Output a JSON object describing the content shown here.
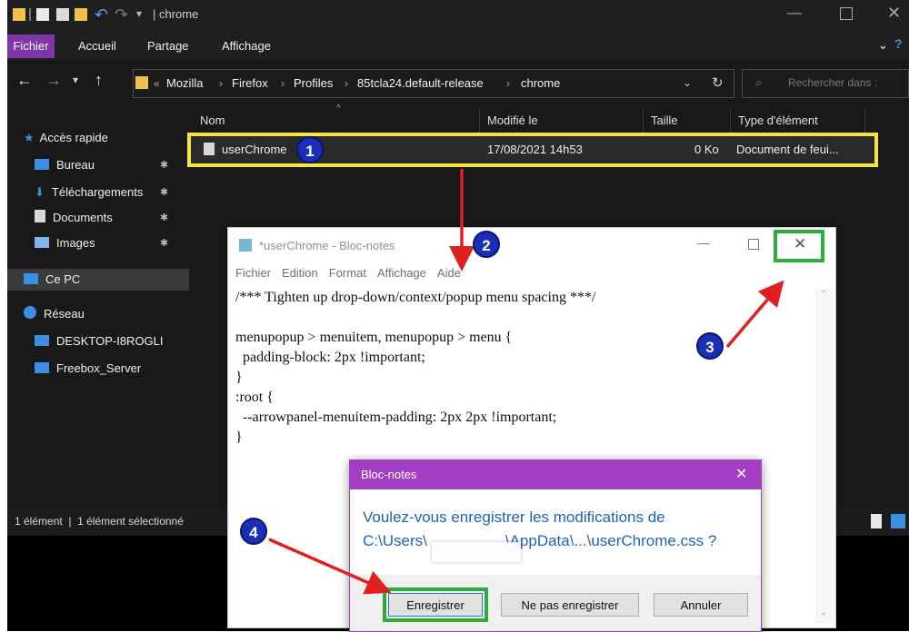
{
  "explorer": {
    "window_title": "chrome",
    "ribbon_tabs": [
      "Fichier",
      "Accueil",
      "Partage",
      "Affichage"
    ],
    "address": [
      "Mozilla",
      "Firefox",
      "Profiles",
      "85tcla24.default-release",
      "chrome"
    ],
    "search_placeholder": "Rechercher dans :",
    "sidebar": {
      "quick_access": "Accès rapide",
      "items": [
        {
          "label": "Bureau",
          "icon": "desktop-icon"
        },
        {
          "label": "Téléchargements",
          "icon": "download-icon"
        },
        {
          "label": "Documents",
          "icon": "documents-icon"
        },
        {
          "label": "Images",
          "icon": "images-icon"
        }
      ],
      "this_pc": "Ce PC",
      "network": "Réseau",
      "network_items": [
        "DESKTOP-I8ROGLI",
        "Freebox_Server"
      ]
    },
    "columns": [
      "Nom",
      "Modifié le",
      "Taille",
      "Type d'élément"
    ],
    "file": {
      "name": "userChrome",
      "modified": "17/08/2021 14h53",
      "size": "0 Ko",
      "type": "Document de feui..."
    },
    "status": {
      "count": "1 élément",
      "selected": "1 élément sélectionné"
    }
  },
  "notepad": {
    "title": "*userChrome - Bloc-notes",
    "menu": [
      "Fichier",
      "Edition",
      "Format",
      "Affichage",
      "Aide"
    ],
    "content": "/*** Tighten up drop-down/context/popup menu spacing ***/\n\nmenupopup > menuitem, menupopup > menu {\n  padding-block: 2px !important;\n}\n:root {\n  --arrowpanel-menuitem-padding: 2px 2px !important;\n}"
  },
  "dialog": {
    "title": "Bloc-notes",
    "message_line1": "Voulez-vous enregistrer les modifications de",
    "message_line2_start": "C:\\Users\\",
    "message_line2_end": "\\AppData\\...\\userChrome.css ?",
    "buttons": {
      "save": "Enregistrer",
      "dont_save": "Ne pas enregistrer",
      "cancel": "Annuler"
    }
  },
  "annotations": {
    "step1": "1",
    "step2": "2",
    "step3": "3",
    "step4": "4"
  },
  "colors": {
    "highlight_yellow": "#f4e542",
    "highlight_green": "#2faa3c",
    "arrow_red": "#e0201e",
    "badge_blue": "#1a2fb8",
    "accent_purple": "#a43fc5"
  }
}
